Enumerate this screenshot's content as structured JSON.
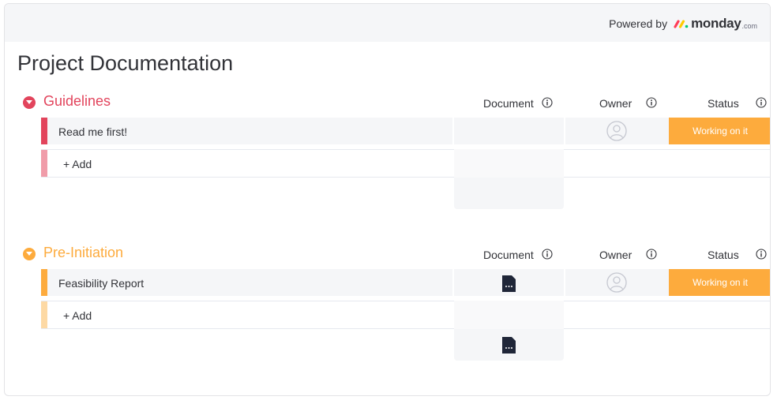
{
  "header": {
    "powered_by": "Powered by",
    "brand_name": "monday",
    "brand_suffix": ".com"
  },
  "page": {
    "title": "Project Documentation"
  },
  "columns": {
    "document": "Document",
    "owner": "Owner",
    "status": "Status"
  },
  "groups": [
    {
      "title": "Guidelines",
      "color": "#e2445c",
      "light_color": "#f09ca9",
      "items": [
        {
          "name": "Read me first!",
          "status": "Working on it",
          "has_document": false
        }
      ],
      "add_label": "+ Add",
      "summary_has_document": false
    },
    {
      "title": "Pre-Initiation",
      "color": "#fdab3d",
      "light_color": "#fdd9a4",
      "items": [
        {
          "name": "Feasibility Report",
          "status": "Working on it",
          "has_document": true
        }
      ],
      "add_label": "+ Add",
      "summary_has_document": true
    }
  ],
  "colors": {
    "status_working_on_it": "#fdab3d",
    "row_background": "#f5f6f8",
    "document_icon": "#1f2638"
  },
  "icons": {
    "collapse": "chevron-down-icon",
    "info": "info-icon",
    "owner": "person-avatar-icon",
    "document": "file-icon"
  }
}
